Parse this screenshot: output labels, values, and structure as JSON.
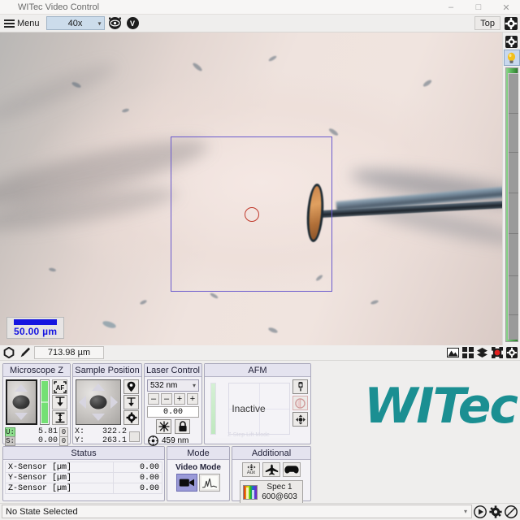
{
  "window": {
    "title": "WITec Video Control",
    "minimize": "–",
    "maximize": "□",
    "close": "✕"
  },
  "toolbar": {
    "menu_label": "Menu",
    "objective": "40x",
    "objective_caret": "▾",
    "focus_icon": "focus-target-icon",
    "video_icon": "V",
    "top_button": "Top",
    "settings_icon": "gear-icon"
  },
  "video": {
    "scalebar_value": "50.00 µm",
    "scan_rect_name": "scan-area-rectangle",
    "laser_spot_name": "laser-spot-marker",
    "rail": {
      "gear_icon": "gear-icon",
      "lamp_icon": "lightbulb-icon",
      "brightness_slider": "brightness-slider"
    }
  },
  "measurebar": {
    "shape_icon": "polygon-icon",
    "pencil_icon": "pencil-icon",
    "distance_value": "713.98 µm",
    "right_icons": [
      "image-icon",
      "grid-icon",
      "layers-icon",
      "target-record-icon",
      "settings-icon"
    ]
  },
  "panels": {
    "microscope_z": {
      "title": "Microscope Z",
      "af_button": "AF",
      "down_button": "move-down-icon",
      "range_button": "range-icon",
      "rows": [
        {
          "tag": "U:",
          "value": "5.81",
          "unit": "0"
        },
        {
          "tag": "S:",
          "value": "0.00",
          "unit": "0"
        }
      ]
    },
    "sample_position": {
      "title": "Sample Position",
      "marker_button": "map-pin-icon",
      "down_button": "move-down-icon",
      "gear_button": "gear-icon",
      "x_label": "X:",
      "x_value": "322.2",
      "y_label": "Y:",
      "y_value": "263.1",
      "corner_button": "zero-icon"
    },
    "laser_control": {
      "title": "Laser Control",
      "wavelength": "532 nm",
      "caret": "▾",
      "buttons": [
        "–",
        "–",
        "+",
        "+"
      ],
      "power_value": "0.00",
      "align_button": "laser-align-icon",
      "lock_button": "lock-icon",
      "spot_icon": "crosshair-icon",
      "spot_value": "459 nm"
    },
    "afm": {
      "title": "AFM",
      "state": "Inactive",
      "footer": "Z-Step Lift Mode",
      "buttons": [
        "tip-approach-icon",
        "retract-icon",
        "move-icon"
      ]
    },
    "status": {
      "title": "Status",
      "rows": [
        {
          "label": "X-Sensor [µm]",
          "value": "0.00"
        },
        {
          "label": "Y-Sensor [µm]",
          "value": "0.00"
        },
        {
          "label": "Z-Sensor [µm]",
          "value": "0.00"
        }
      ]
    },
    "mode": {
      "title": "Mode",
      "label": "Video Mode",
      "video_button": "video-camera-icon",
      "spectrum_button": "spectrum-icon"
    },
    "additional": {
      "title": "Additional",
      "aux_label": "Aux",
      "aux_button": "aux-icon",
      "plane_button": "airplane-icon",
      "gamepad_button": "gamepad-icon",
      "spec_line1": "Spec 1",
      "spec_line2": "600@603",
      "spec_icon": "spectrum-color-icon"
    }
  },
  "logo": {
    "text": "WITec",
    "color": "#1b8f92"
  },
  "statusbar": {
    "state": "No State Selected",
    "caret": "▾",
    "play_icon": "play-icon",
    "gear_icon": "gear-icon",
    "stop_icon": "prohibited-icon"
  }
}
